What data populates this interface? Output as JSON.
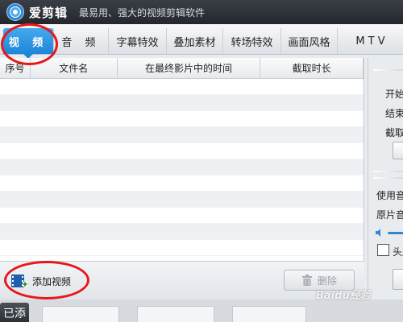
{
  "app": {
    "title": "爱剪辑",
    "slogan": "最易用、强大的视频剪辑软件"
  },
  "tabs": [
    {
      "label": "视 频",
      "active": true
    },
    {
      "label": "音 频",
      "active": false
    },
    {
      "label": "字幕特效",
      "active": false
    },
    {
      "label": "叠加素材",
      "active": false
    },
    {
      "label": "转场特效",
      "active": false
    },
    {
      "label": "画面风格",
      "active": false
    },
    {
      "label": "M T V",
      "active": false
    }
  ],
  "table": {
    "columns": [
      "序号",
      "文件名",
      "在最终影片中的时间",
      "截取时长"
    ],
    "rows": []
  },
  "right_panel": {
    "start_label": "开始",
    "end_label": "结束",
    "clip_label": "截取",
    "use_audio_label": "使用音",
    "original_audio_label": "原片音",
    "head_label": "头尾"
  },
  "actions": {
    "add_video": "添加视频",
    "delete": "删除"
  },
  "bottom": {
    "side_tab": "已添"
  },
  "watermark": "Baidu经验",
  "colors": {
    "accent": "#1e86d8",
    "annotation": "#e5181b",
    "titlebar": "#2b2f35"
  }
}
